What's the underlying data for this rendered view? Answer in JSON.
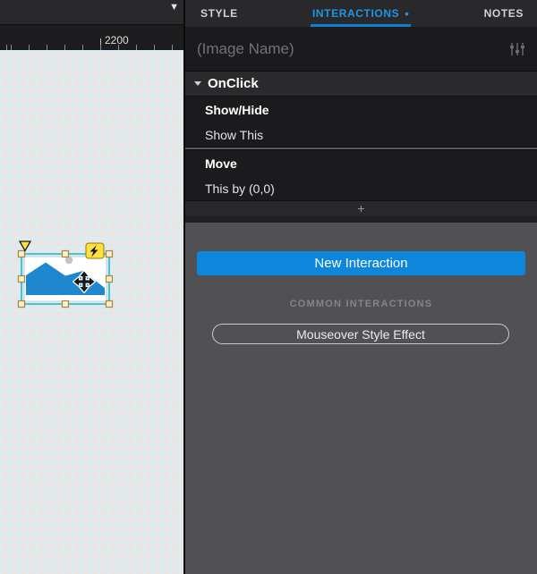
{
  "canvas": {
    "ruler_label": "2200",
    "widget": {
      "type": "image-placeholder",
      "selected": true,
      "has_interaction": true,
      "has_note": true
    }
  },
  "panel": {
    "tabs": [
      {
        "label": "STYLE",
        "active": false
      },
      {
        "label": "INTERACTIONS",
        "active": true,
        "badge": "•"
      },
      {
        "label": "NOTES",
        "active": false
      }
    ],
    "widget_name_placeholder": "(Image Name)",
    "events": [
      {
        "trigger": "OnClick",
        "actions": [
          {
            "name": "Show/Hide",
            "detail": "Show This"
          },
          {
            "name": "Move",
            "detail": "This by (0,0)"
          }
        ]
      }
    ],
    "add_label": "+",
    "new_interaction_label": "New Interaction",
    "common_interactions_label": "COMMON INTERACTIONS",
    "common_actions": [
      "Mouseover Style Effect"
    ]
  },
  "colors": {
    "accent_blue": "#0e86dc",
    "tab_active_blue": "#1e96e6",
    "selection_cyan": "#3cc8da",
    "interaction_yellow": "#ffe13e",
    "placeholder_blue": "#1f87d0",
    "panel_gray": "#515153",
    "panel_dark": "#1b1b1d"
  }
}
